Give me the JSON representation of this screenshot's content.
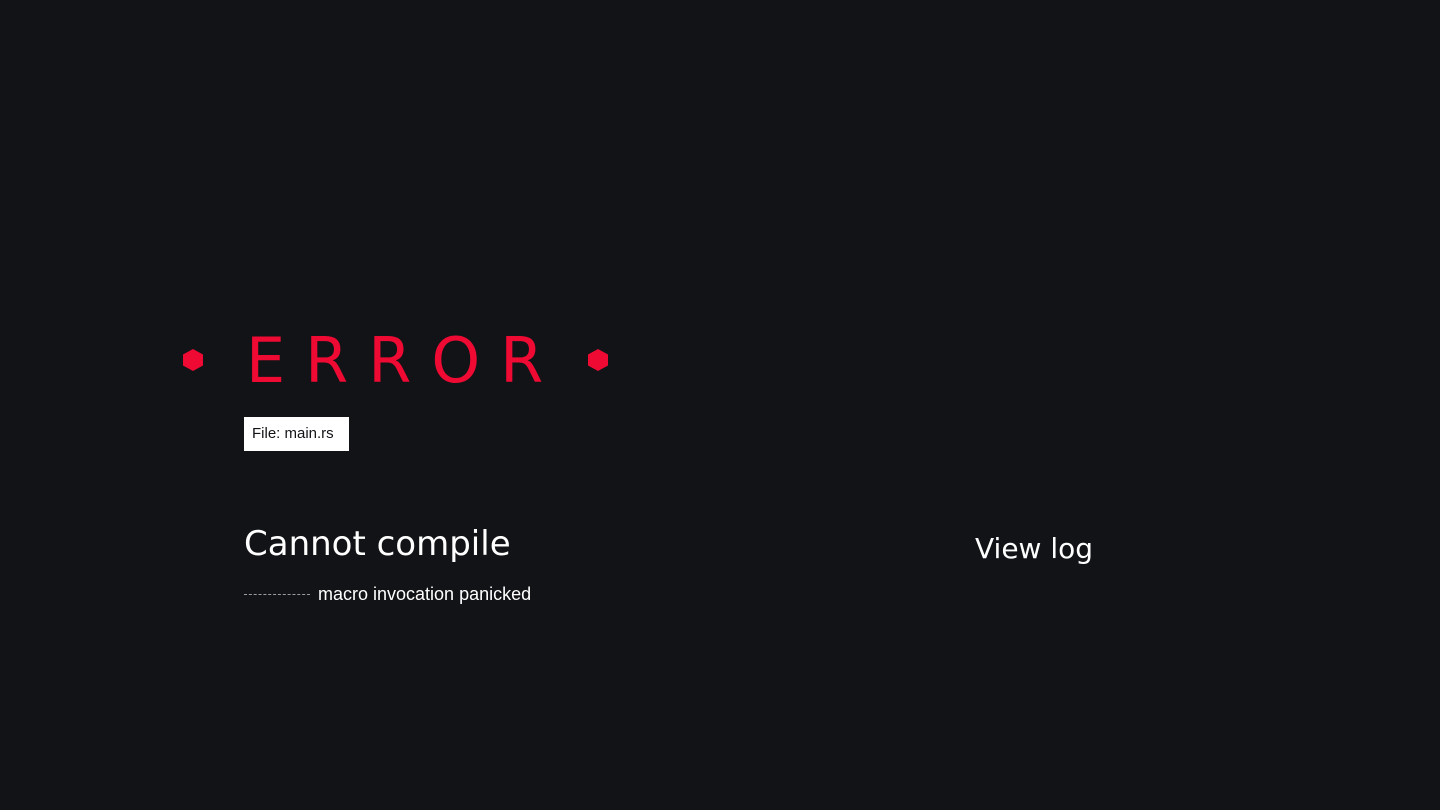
{
  "error": {
    "title": "ERROR",
    "file_label": "File: main.rs",
    "headline": "Cannot compile",
    "detail": "macro invocation panicked",
    "accent_color": "#ee0a33",
    "marker_icon": "hexagon-icon"
  },
  "actions": {
    "view_log_label": "View log"
  },
  "colors": {
    "background": "#121317",
    "text": "#ffffff"
  }
}
